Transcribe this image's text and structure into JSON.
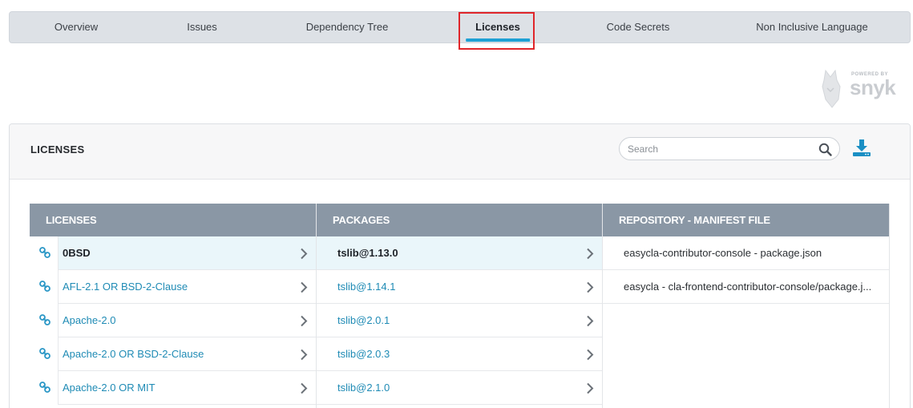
{
  "tabs": [
    {
      "label": "Overview",
      "active": false
    },
    {
      "label": "Issues",
      "active": false
    },
    {
      "label": "Dependency Tree",
      "active": false
    },
    {
      "label": "Licenses",
      "active": true
    },
    {
      "label": "Code Secrets",
      "active": false
    },
    {
      "label": "Non Inclusive Language",
      "active": false
    }
  ],
  "logo": {
    "powered_by": "POWERED BY",
    "brand": "snyk"
  },
  "panel": {
    "title": "LICENSES",
    "search_placeholder": "Search",
    "download_icon": "download-icon"
  },
  "table": {
    "headers": {
      "licenses": "LICENSES",
      "packages": "PACKAGES",
      "repository": "REPOSITORY - MANIFEST FILE"
    },
    "licenses": [
      {
        "name": "0BSD",
        "selected": true
      },
      {
        "name": "AFL-2.1 OR BSD-2-Clause",
        "selected": false
      },
      {
        "name": "Apache-2.0",
        "selected": false
      },
      {
        "name": "Apache-2.0 OR BSD-2-Clause",
        "selected": false
      },
      {
        "name": "Apache-2.0 OR MIT",
        "selected": false
      }
    ],
    "packages": [
      {
        "name": "tslib@1.13.0",
        "selected": true
      },
      {
        "name": "tslib@1.14.1",
        "selected": false
      },
      {
        "name": "tslib@2.0.1",
        "selected": false
      },
      {
        "name": "tslib@2.0.3",
        "selected": false
      },
      {
        "name": "tslib@2.1.0",
        "selected": false
      }
    ],
    "repositories": [
      "easycla-contributor-console - package.json",
      "easycla - cla-frontend-contributor-console/package.j..."
    ]
  },
  "colors": {
    "accent": "#1ea0d4",
    "link": "#1f8bb5",
    "header_bg": "#8a97a5",
    "highlight_outline": "#e0262b"
  }
}
